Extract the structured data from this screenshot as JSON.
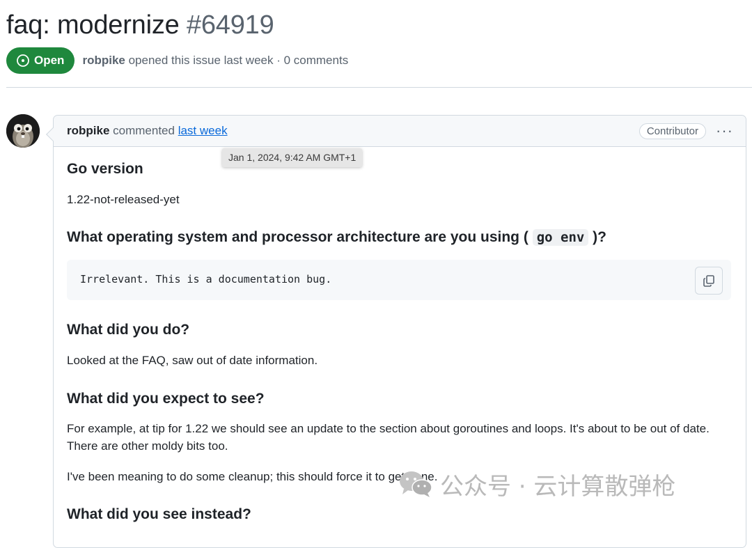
{
  "issue": {
    "title": "faq: modernize",
    "number": "#64919",
    "state": "Open",
    "author": "robpike",
    "meta_suffix": "opened this issue last week · 0 comments"
  },
  "comment": {
    "author": "robpike",
    "action": "commented",
    "time_link": "last week",
    "role_badge": "Contributor",
    "tooltip": "Jan 1, 2024, 9:42 AM GMT+1",
    "sections": {
      "go_version_heading": "Go version",
      "go_version_value": "1.22-not-released-yet",
      "os_heading_prefix": "What operating system and processor architecture are you using (",
      "os_heading_code": "go env",
      "os_heading_suffix": ")?",
      "os_code_block": "Irrelevant. This is a documentation bug.",
      "did_heading": "What did you do?",
      "did_text": "Looked at the FAQ, saw out of date information.",
      "expect_heading": "What did you expect to see?",
      "expect_text_line1": "For example, at tip for 1.22 we should see an update to the section about goroutines and loops. It's about to be out of date.",
      "expect_text_line2": "There are other moldy bits too.",
      "expect_text_2": "I've been meaning to do some cleanup; this should force it to get done.",
      "instead_heading": "What did you see instead?"
    }
  },
  "watermark": {
    "text": "公众号 · 云计算散弹枪"
  },
  "icons": {
    "state": "issue-open-icon",
    "copy": "copy-icon",
    "kebab": "kebab-horizontal-icon",
    "avatar": "gopher-avatar",
    "watermark": "wechat-icon"
  },
  "colors": {
    "open_green": "#1f883d",
    "link_blue": "#0969da",
    "muted": "#59636e",
    "border": "#d1d9e0"
  }
}
